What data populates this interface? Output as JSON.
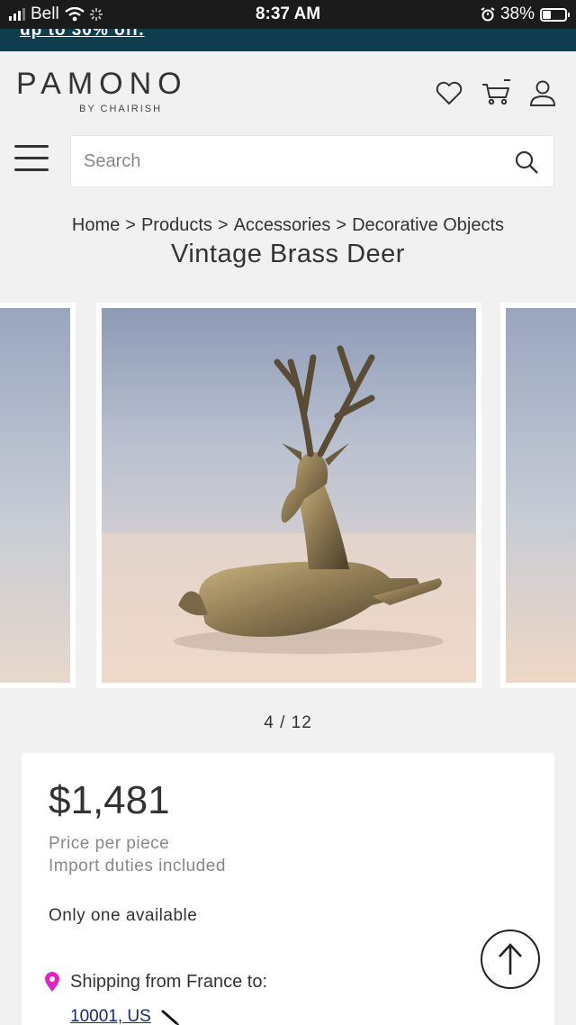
{
  "status_bar": {
    "carrier": "Bell",
    "time": "8:37 AM",
    "battery": "38%"
  },
  "promo": {
    "text": "up to 30% off."
  },
  "header": {
    "logo": "PAMONO",
    "logo_sub": "BY CHAIRISH"
  },
  "search": {
    "placeholder": "Search"
  },
  "breadcrumb": [
    "Home",
    "Products",
    "Accessories",
    "Decorative Objects"
  ],
  "breadcrumb_separator": ">",
  "product": {
    "title": "Vintage Brass Deer",
    "image_counter": "4 / 12",
    "price": "$1,481",
    "price_note": "Price per piece",
    "duties_note": "Import duties included",
    "availability": "Only one available",
    "shipping_label": "Shipping from France to:",
    "zip": "10001, US"
  },
  "colors": {
    "promo_bg": "#0f3d4f",
    "link": "#1a2a6c",
    "pin": "#e020c8"
  }
}
